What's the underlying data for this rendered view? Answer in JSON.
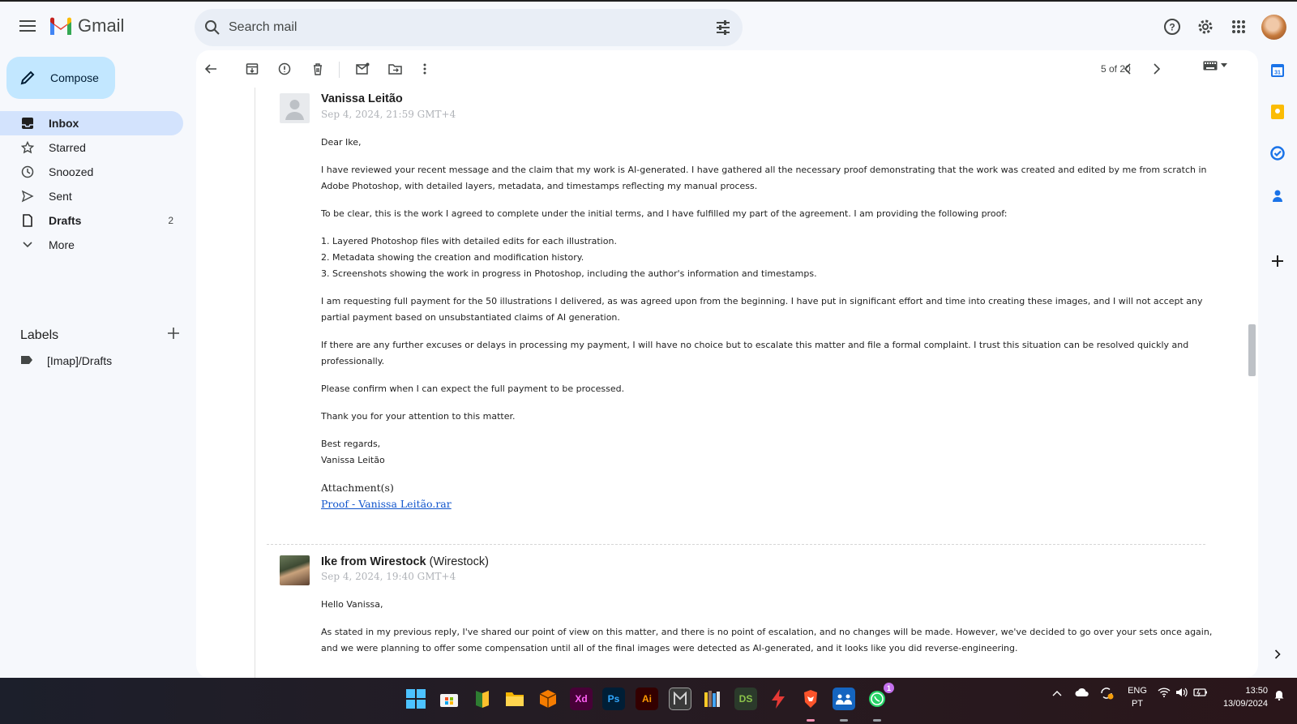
{
  "app": {
    "name": "Gmail"
  },
  "search": {
    "placeholder": "Search mail"
  },
  "sidebar": {
    "compose_label": "Compose",
    "items": [
      {
        "label": "Inbox",
        "icon": "inbox-icon",
        "count": ""
      },
      {
        "label": "Starred",
        "icon": "star-icon",
        "count": ""
      },
      {
        "label": "Snoozed",
        "icon": "clock-icon",
        "count": ""
      },
      {
        "label": "Sent",
        "icon": "send-icon",
        "count": ""
      },
      {
        "label": "Drafts",
        "icon": "file-icon",
        "count": "2"
      },
      {
        "label": "More",
        "icon": "chevron-down-icon",
        "count": ""
      }
    ],
    "labels_title": "Labels",
    "labels": [
      {
        "label": "[Imap]/Drafts"
      }
    ]
  },
  "toolbar": {
    "pager": "5 of 20"
  },
  "thread": {
    "messages": [
      {
        "sender": "Vanissa Leitão",
        "org": "",
        "date": "Sep 4, 2024, 21:59 GMT+4",
        "paragraphs": [
          "Dear Ike,",
          "I have reviewed your recent message and the claim that my work is AI-generated. I have gathered all the necessary proof demonstrating that the work was created and edited by me from scratch in Adobe Photoshop, with detailed layers, metadata, and timestamps reflecting my manual process.",
          "To be clear, this is the work I agreed to complete under the initial terms, and I have fulfilled my part of the agreement. I am providing the following proof:"
        ],
        "list": [
          "1. Layered Photoshop files with detailed edits for each illustration.",
          "2. Metadata showing the creation and modification history.",
          "3. Screenshots showing the work in progress in Photoshop, including the author's information and timestamps."
        ],
        "paragraphs2": [
          "I am requesting full payment for the 50 illustrations I delivered, as was agreed upon from the beginning. I have put in significant effort and time into creating these images, and I will not accept any partial payment based on unsubstantiated claims of AI generation.",
          "If there are any further excuses or delays in processing my payment, I will have no choice but to escalate this matter and file a formal complaint. I trust this situation can be resolved quickly and professionally.",
          "Please confirm when I can expect the full payment to be processed.",
          "Thank you for your attention to this matter."
        ],
        "signoff": [
          "Best regards,",
          "Vanissa Leitão"
        ],
        "attachments_title": "Attachment(s)",
        "attachment": "Proof - Vanissa Leitão.rar"
      },
      {
        "sender": "Ike from Wirestock",
        "org": "(Wirestock)",
        "date": "Sep 4, 2024, 19:40 GMT+4",
        "paragraphs": [
          "Hello Vanissa,",
          "As stated in my previous reply, I've shared our point of view on this matter, and there is no point of escalation, and no changes will be made. However, we've decided to go over your sets once again, and we were planning to offer some compensation until all of the final images were detected as AI-generated, and it looks like you did reverse-engineering."
        ]
      }
    ]
  },
  "taskbar": {
    "apps": [
      "windows-start",
      "store",
      "app-books",
      "file-explorer",
      "package",
      "adobe-xd",
      "photoshop",
      "illustrator",
      "app-im",
      "app-library",
      "app-ds",
      "app-flash",
      "brave-browser",
      "app-people",
      "whatsapp"
    ],
    "app_labels": {
      "xd": "Xd",
      "ps": "Ps",
      "ai": "Ai",
      "ds": "DS"
    },
    "whatsapp_badge": "1",
    "lang_top": "ENG",
    "lang_bottom": "PT",
    "time": "13:50",
    "date": "13/09/2024"
  },
  "colors": {
    "accent": "#c2e7ff",
    "active_nav": "#d3e3fd",
    "link": "#1155cc"
  }
}
